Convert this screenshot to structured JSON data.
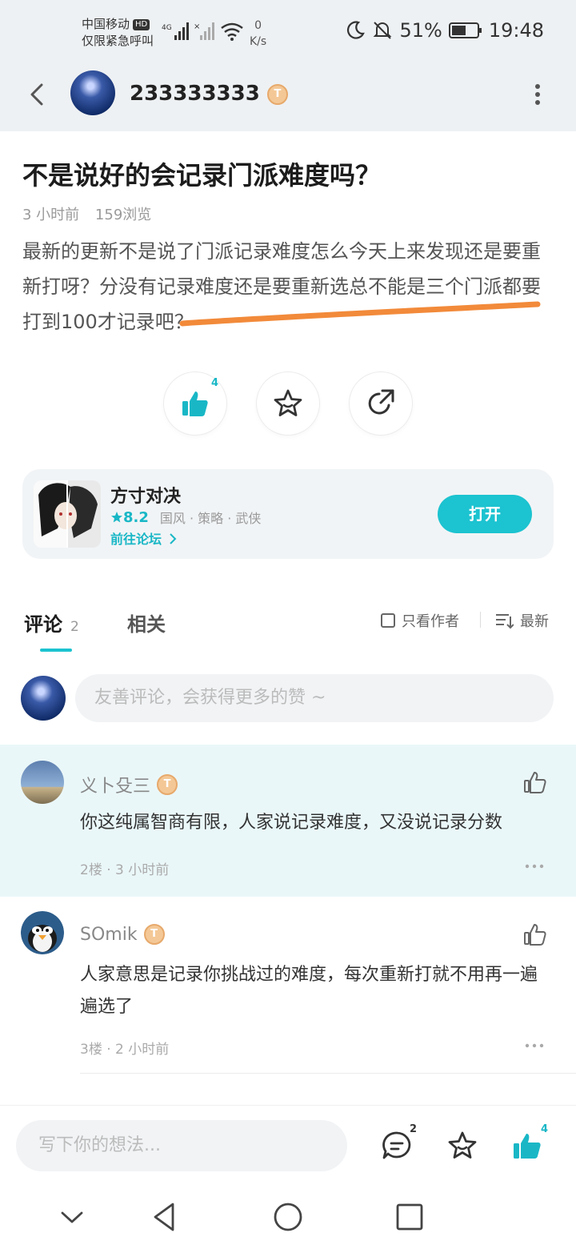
{
  "status_bar": {
    "carrier": "中国移动",
    "hd": "HD",
    "carrier_sub": "仅限紧急呼叫",
    "network": "4G",
    "net_speed_value": "0",
    "net_speed_unit": "K/s",
    "battery": "51%",
    "time": "19:48"
  },
  "top_bar": {
    "username": "233333333",
    "level_badge": "T"
  },
  "post": {
    "title": "不是说好的会记录门派难度吗？",
    "time": "3 小时前",
    "views": "159浏览",
    "content": "最新的更新不是说了门派记录难度怎么今天上来发现还是要重新打呀？分没有记录难度还是要重新选总不能是三个门派都要打到100才记录吧？",
    "like_count": "4"
  },
  "game": {
    "name": "方寸对决",
    "rating": "8.2",
    "tags": "国风 · 策略 · 武侠",
    "forum_link": "前往论坛",
    "open_label": "打开"
  },
  "tabs": {
    "comments_label": "评论",
    "comments_count": "2",
    "related_label": "相关",
    "only_author": "只看作者",
    "sort_label": "最新"
  },
  "comment_input": {
    "placeholder": "友善评论，会获得更多的赞 ~"
  },
  "comments": [
    {
      "name": "义卜殳三",
      "badge": "T",
      "text": "你这纯属智商有限，人家说记录难度，又没说记录分数",
      "floor_time": "2楼 · 3 小时前"
    },
    {
      "name": "SOmik",
      "badge": "T",
      "text": "人家意思是记录你挑战过的难度，每次重新打就不用再一遍遍选了",
      "floor_time": "3楼 · 2 小时前"
    }
  ],
  "bottom_bar": {
    "placeholder": "写下你的想法...",
    "comment_count": "2",
    "like_count": "4"
  },
  "colors": {
    "accent": "#1cc3d0",
    "highlight_bg": "#eaf7f9",
    "scribble": "#f28a3a"
  }
}
